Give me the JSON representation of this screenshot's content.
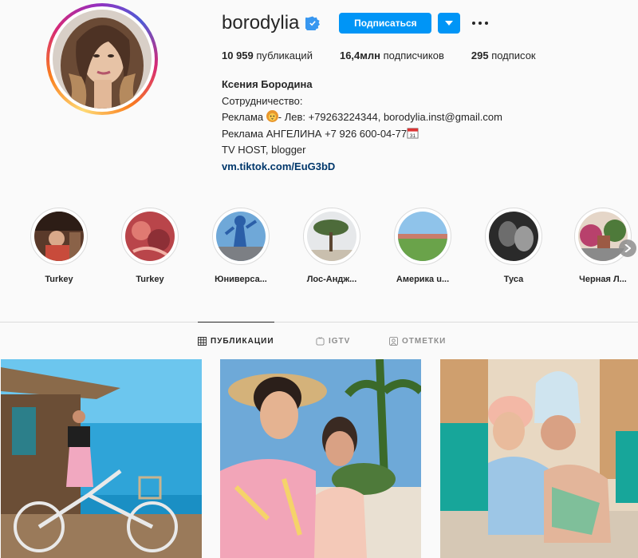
{
  "profile": {
    "username": "borodylia",
    "follow_label": "Подписаться",
    "stats": {
      "posts_count": "10 959",
      "posts_label": "публикаций",
      "followers_count": "16,4млн",
      "followers_label": "подписчиков",
      "following_count": "295",
      "following_label": "подписок"
    },
    "bio": {
      "full_name": "Ксения Бородина",
      "line1": "Сотрудничество:",
      "line2_a": "Реклама ",
      "line2_b": "- Лев: +79263224344, borodylia.inst@gmail.com",
      "line3": "Реклама АНГЕЛИНА +7 926 600-04-77",
      "line4": "TV HOST, blogger",
      "link": "vm.tiktok.com/EuG3bD"
    }
  },
  "stories": [
    {
      "label": "Turkey"
    },
    {
      "label": "Turkey"
    },
    {
      "label": "Юниверса..."
    },
    {
      "label": "Лос-Андж..."
    },
    {
      "label": "Америка u..."
    },
    {
      "label": "Туса"
    },
    {
      "label": "Черная Л..."
    }
  ],
  "tabs": [
    {
      "label": "ПУБЛИКАЦИИ"
    },
    {
      "label": "IGTV"
    },
    {
      "label": "ОТМЕТКИ"
    }
  ],
  "colors": {
    "accent": "#0095f6",
    "link": "#00376b"
  },
  "icons": [
    "verified-badge-icon",
    "chevron-down-icon",
    "more-options-icon",
    "lion-emoji-icon",
    "calendar-emoji-icon",
    "grid-icon",
    "igtv-icon",
    "tagged-icon",
    "chevron-right-icon"
  ]
}
